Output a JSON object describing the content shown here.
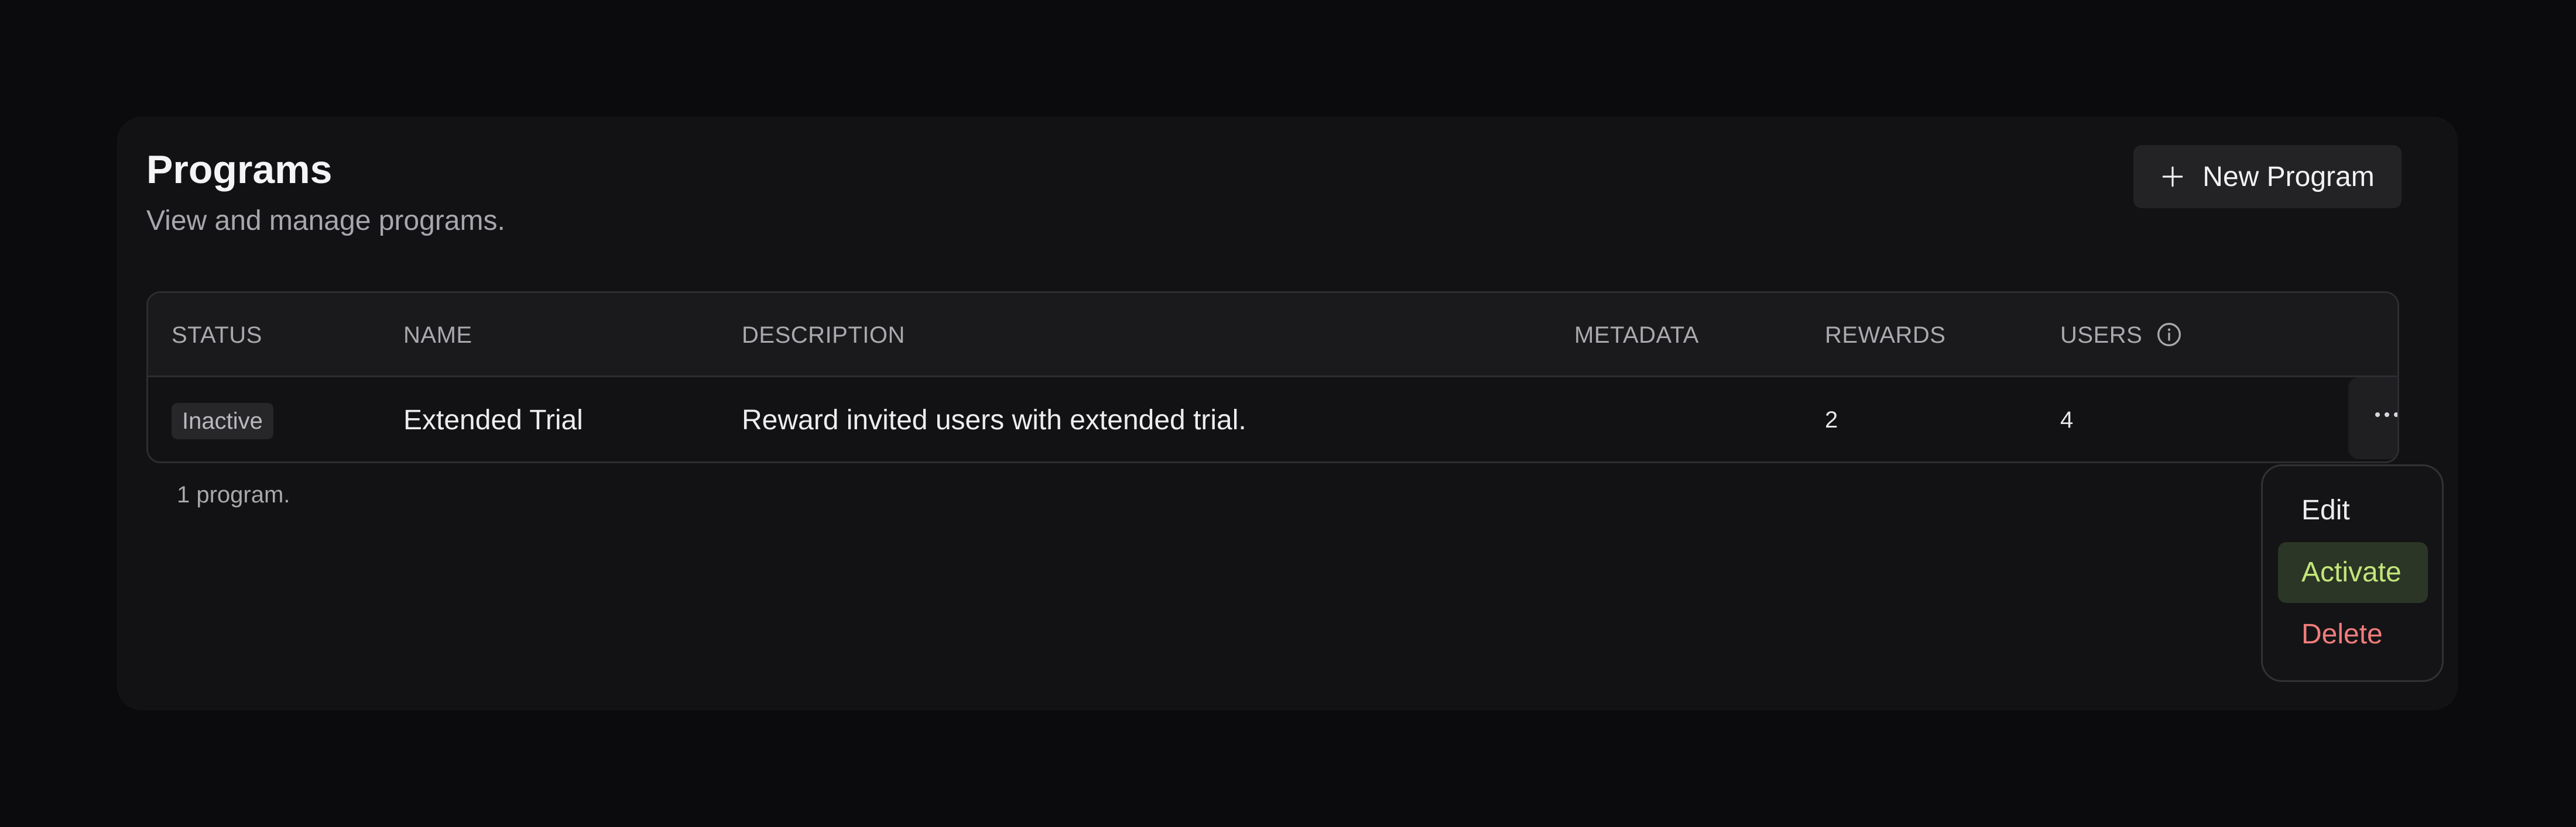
{
  "header": {
    "title": "Programs",
    "subtitle": "View and manage programs.",
    "new_button_label": "New Program"
  },
  "table": {
    "columns": [
      "STATUS",
      "NAME",
      "DESCRIPTION",
      "METADATA",
      "REWARDS",
      "USERS"
    ],
    "rows": [
      {
        "status": "Inactive",
        "name": "Extended Trial",
        "description": "Reward invited users with extended trial.",
        "metadata": "",
        "rewards": "2",
        "users": "4"
      }
    ],
    "footer_count": "1 program."
  },
  "row_menu": {
    "items": [
      "Edit",
      "Activate",
      "Delete"
    ],
    "highlighted": "Activate"
  },
  "icons": {
    "new_button": "plus-icon",
    "users_header": "info-icon",
    "row_actions": "more-horizontal-icon"
  },
  "colors": {
    "background": "#0b0b0d",
    "card": "#121214",
    "activate_text": "#c4e67a",
    "activate_bg": "#2b3626",
    "delete_text": "#f07d7b"
  }
}
